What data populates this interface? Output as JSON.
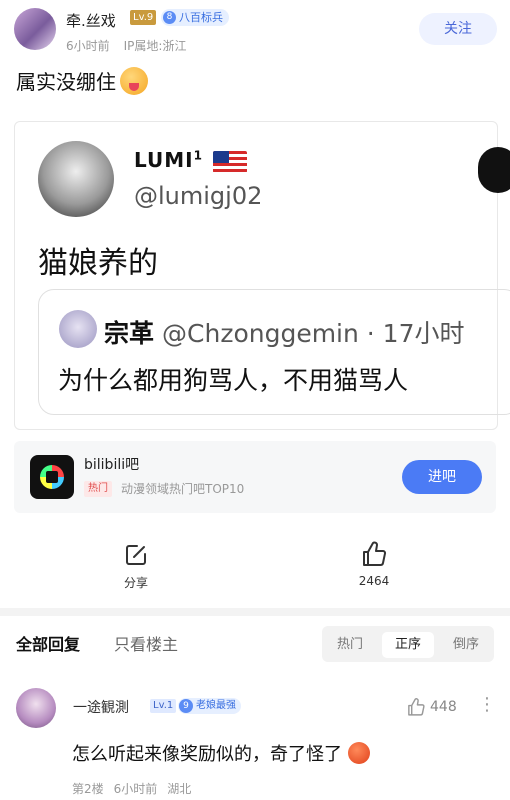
{
  "post": {
    "author": "牵.丝戏",
    "level": "Lv.9",
    "badge_num": "8",
    "badge_label": "八百标兵",
    "time": "6小时前",
    "location": "IP属地:浙江",
    "follow_label": "关注",
    "text": "属实没绷住",
    "emoji": "squinting-tongue-emoji"
  },
  "tweet": {
    "name": "LUMI",
    "name_sup": "1",
    "handle": "@lumigj02",
    "body": "猫娘养的",
    "quote": {
      "name": "宗革",
      "handle": "@Chzonggemin · 17小时",
      "body": "为什么都用狗骂人，不用猫骂人"
    }
  },
  "forum": {
    "name": "bilibili吧",
    "hot_tag": "热门",
    "desc": "动漫领域热门吧TOP10",
    "enter_label": "进吧"
  },
  "actions": {
    "share_label": "分享",
    "like_count": "2464"
  },
  "comments_header": {
    "all_label": "全部回复",
    "op_only_label": "只看楼主",
    "sort_options": [
      "热门",
      "正序",
      "倒序"
    ],
    "active_sort": "正序"
  },
  "comment": {
    "author": "一途観測",
    "level": "Lv.1",
    "badge_num": "9",
    "badge_label": "老娘最强",
    "likes": "448",
    "text": "怎么听起来像奖励似的，奇了怪了",
    "floor": "第2楼",
    "time": "6小时前",
    "location": "湖北"
  },
  "colors": {
    "accent": "#4b7bf5",
    "follow_text": "#4a68d8",
    "level_gold": "#c99a3d",
    "hot_red": "#e04c4c"
  }
}
